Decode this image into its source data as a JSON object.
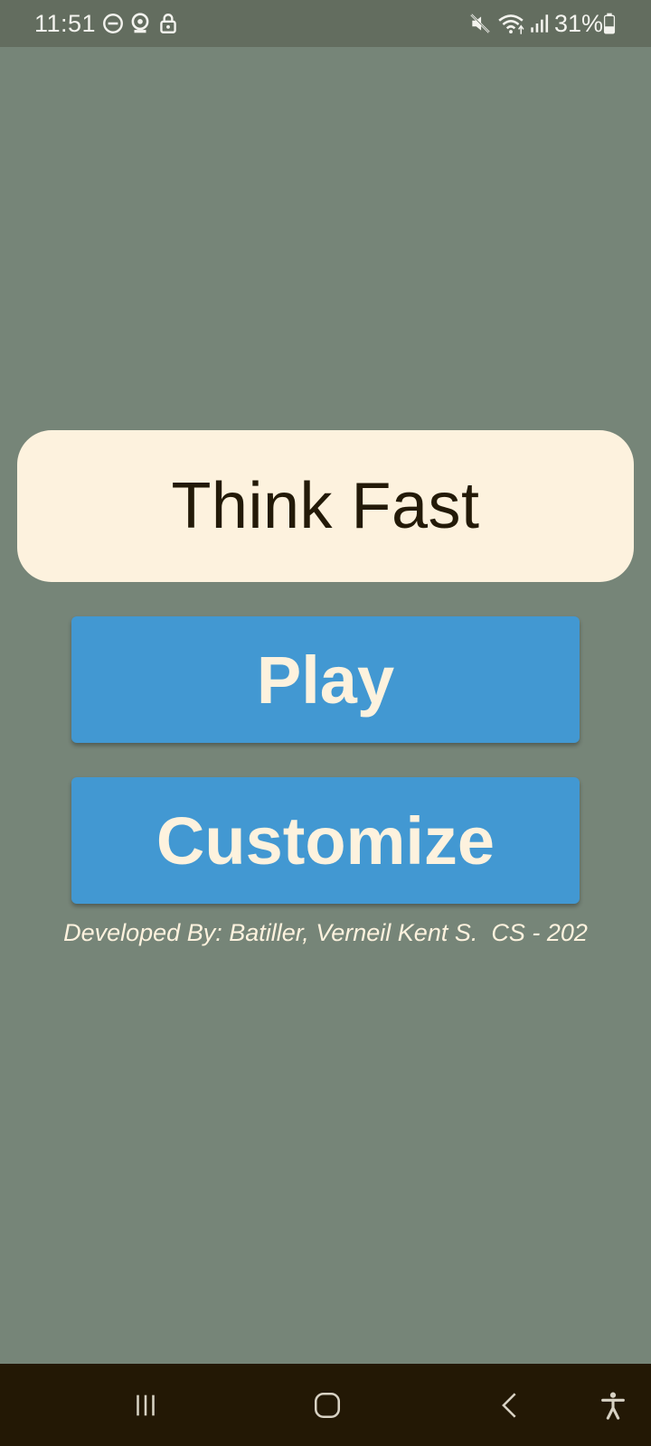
{
  "status_bar": {
    "time": "11:51",
    "battery": "31%",
    "left_icons": [
      "do-not-disturb-icon",
      "hotspot-icon",
      "lock-icon"
    ],
    "right_icons": [
      "mute-icon",
      "wifi-icon",
      "signal-icon",
      "battery-icon"
    ]
  },
  "app": {
    "title": "Think Fast",
    "play_label": "Play",
    "customize_label": "Customize",
    "credits": "Developed By: Batiller, Verneil Kent S.  CS - 202"
  },
  "nav_bar": {
    "items": [
      "recent-apps-icon",
      "home-icon",
      "back-icon",
      "accessibility-icon"
    ]
  },
  "colors": {
    "background": "#768578",
    "status_bar": "#636d5f",
    "card": "#fdf2de",
    "button": "#4298d2",
    "nav_bar": "#231805"
  }
}
